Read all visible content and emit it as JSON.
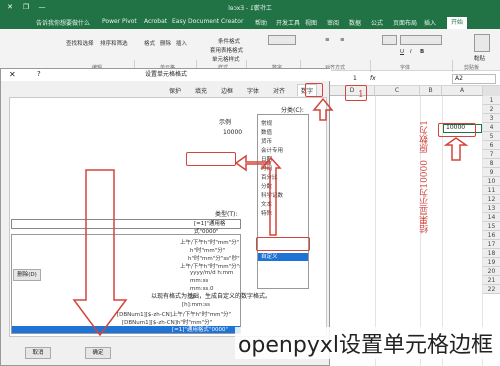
{
  "excel": {
    "window_title": "工作簿1 - Excel",
    "tabs": [
      "开始",
      "插入",
      "页面布局",
      "公式",
      "数据",
      "审阅",
      "视图",
      "开发工具",
      "帮助",
      "Easy Document Creator",
      "Acrobat",
      "Power Pivot",
      "告诉我你想要做什么"
    ],
    "ribbon_labels": [
      "剪贴板",
      "字体",
      "对齐方式",
      "数字",
      "样式",
      "单元格",
      "编辑"
    ],
    "ribbon_items": [
      "黏贴",
      "字体",
      "条件格式",
      "套用表格格式",
      "单元格样式",
      "插入",
      "删除",
      "格式",
      "排序和筛选",
      "查找和选择"
    ],
    "name_box": "A2",
    "formula_fx": "fx",
    "formula_value": "1",
    "columns": [
      "D",
      "C",
      "B",
      "A"
    ],
    "rows": [
      "1",
      "2",
      "3",
      "4",
      "5",
      "6",
      "7",
      "8",
      "9",
      "10",
      "11",
      "12",
      "13",
      "14",
      "15",
      "16",
      "17",
      "18",
      "19",
      "20",
      "21",
      "22"
    ],
    "cell_a2": "10000"
  },
  "dialog": {
    "title": "设置单元格格式",
    "tabs": [
      "数字",
      "对齐",
      "字体",
      "边框",
      "填充",
      "保护"
    ],
    "active_tab": "数字",
    "category_label": "分类(C):",
    "categories": [
      "常规",
      "数值",
      "货币",
      "会计专用",
      "日期",
      "时间",
      "百分比",
      "分数",
      "科学记数",
      "文本",
      "特殊",
      "自定义"
    ],
    "selected_category": "自定义",
    "sample_label": "示例",
    "sample_value": "10000",
    "type_label": "类型(T):",
    "type_value": "[=1]\"通用格式\"0000\"",
    "formats": [
      "上午/下午h\"时\"mm\"分\"",
      "h\"时\"mm\"分\"",
      "h\"时\"mm\"分\"ss\"秒\"",
      "上午/下午h\"时\"mm\"分\"ss\"秒\"",
      "yyyy/m/d h:mm",
      "mm:ss",
      "mm:ss.0",
      "@",
      "[h]:mm:ss",
      "[DBNum1][$-zh-CN]上午/下午h\"时\"mm\"分\"",
      "[DBNum1][$-zh-CN]h\"时\"mm\"分\"",
      "[=1]\"通用格式\"0000\""
    ],
    "selected_format": "[=1]\"通用格式\"0000\"",
    "delete_button": "删除(D)",
    "hint": "以现有格式为基础，生成自定义的数字格式。",
    "ok_button": "确定",
    "cancel_button": "取消"
  },
  "annotations": {
    "note_original": "原数为1",
    "note_result": "结果显示为10000",
    "cell_callout": "1"
  },
  "caption": "openpyxl设置单元格边框",
  "colors": {
    "excel_green": "#217346",
    "annotation_red": "#d3443c",
    "selection_blue": "#1e73d4"
  }
}
